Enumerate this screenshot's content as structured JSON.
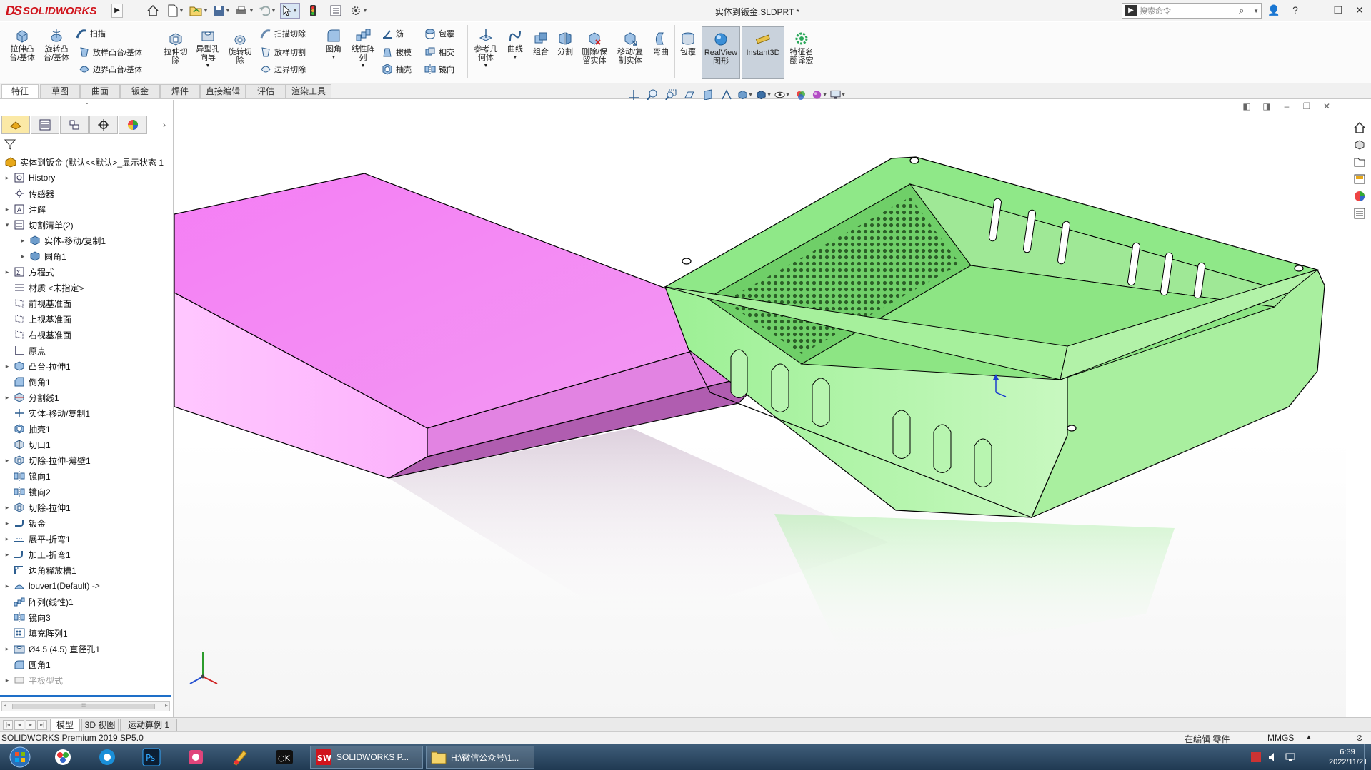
{
  "app": {
    "brand_prefix": "DS",
    "brand_name": "SOLIDWORKS",
    "document_title": "实体到钣金.SLDPRT *"
  },
  "search": {
    "placeholder": "搜索命令"
  },
  "command_manager": {
    "tools_large": [
      {
        "label": "拉伸凸\n台/基体"
      },
      {
        "label": "旋转凸\n台/基体"
      },
      {
        "label": "拉伸切\n除"
      },
      {
        "label": "异型孔\n向导"
      },
      {
        "label": "旋转切\n除"
      },
      {
        "label": "圆角"
      },
      {
        "label": "线性阵\n列"
      },
      {
        "label": "参考几\n何体"
      },
      {
        "label": "曲线"
      },
      {
        "label": "组合"
      },
      {
        "label": "分割"
      },
      {
        "label": "删除/保\n留实体"
      },
      {
        "label": "移动/复\n制实体"
      },
      {
        "label": "弯曲"
      },
      {
        "label": "包覆"
      },
      {
        "label": "RealView\n图形"
      },
      {
        "label": "Instant3D"
      },
      {
        "label": "特征名\n翻译宏"
      }
    ],
    "tools_small": [
      {
        "label": "扫描"
      },
      {
        "label": "放样凸台/基体"
      },
      {
        "label": "边界凸台/基体"
      },
      {
        "label": "扫描切除"
      },
      {
        "label": "放样切割"
      },
      {
        "label": "边界切除"
      },
      {
        "label": "筋"
      },
      {
        "label": "拔模"
      },
      {
        "label": "抽壳"
      },
      {
        "label": "包覆"
      },
      {
        "label": "相交"
      },
      {
        "label": "镜向"
      }
    ]
  },
  "tabs": [
    {
      "label": "特征",
      "active": true
    },
    {
      "label": "草图"
    },
    {
      "label": "曲面"
    },
    {
      "label": "钣金"
    },
    {
      "label": "焊件"
    },
    {
      "label": "直接编辑"
    },
    {
      "label": "评估"
    },
    {
      "label": "渲染工具"
    }
  ],
  "feature_tree": {
    "root": "实体到钣金 (默认<<默认>_显示状态 1",
    "nodes": [
      {
        "label": "History",
        "icon": "history-icon",
        "expand": true,
        "indent": 0
      },
      {
        "label": "传感器",
        "icon": "sensor-icon",
        "expand": false,
        "indent": 0
      },
      {
        "label": "注解",
        "icon": "annotation-icon",
        "expand": true,
        "indent": 0
      },
      {
        "label": "切割清单(2)",
        "icon": "cut-list-icon",
        "expand": "open",
        "indent": 0
      },
      {
        "label": "实体-移动/复制1",
        "icon": "solid-body-icon",
        "expand": true,
        "indent": 1
      },
      {
        "label": "圆角1",
        "icon": "solid-body-icon",
        "expand": true,
        "indent": 1
      },
      {
        "label": "方程式",
        "icon": "equation-icon",
        "expand": true,
        "indent": 0
      },
      {
        "label": "材质 <未指定>",
        "icon": "material-icon",
        "expand": false,
        "indent": 0
      },
      {
        "label": "前视基准面",
        "icon": "plane-icon",
        "expand": false,
        "indent": 0
      },
      {
        "label": "上视基准面",
        "icon": "plane-icon",
        "expand": false,
        "indent": 0
      },
      {
        "label": "右视基准面",
        "icon": "plane-icon",
        "expand": false,
        "indent": 0
      },
      {
        "label": "原点",
        "icon": "origin-icon",
        "expand": false,
        "indent": 0
      },
      {
        "label": "凸台-拉伸1",
        "icon": "extrude-icon",
        "expand": true,
        "indent": 0
      },
      {
        "label": "倒角1",
        "icon": "chamfer-icon",
        "expand": false,
        "indent": 0
      },
      {
        "label": "分割线1",
        "icon": "split-line-icon",
        "expand": true,
        "indent": 0
      },
      {
        "label": "实体-移动/复制1",
        "icon": "move-copy-icon",
        "expand": false,
        "indent": 0
      },
      {
        "label": "抽壳1",
        "icon": "shell-icon",
        "expand": false,
        "indent": 0
      },
      {
        "label": "切口1",
        "icon": "rip-icon",
        "expand": false,
        "indent": 0
      },
      {
        "label": "切除-拉伸-薄壁1",
        "icon": "cut-extrude-icon",
        "expand": true,
        "indent": 0
      },
      {
        "label": "镜向1",
        "icon": "mirror-icon",
        "expand": false,
        "indent": 0
      },
      {
        "label": "镜向2",
        "icon": "mirror-icon",
        "expand": false,
        "indent": 0
      },
      {
        "label": "切除-拉伸1",
        "icon": "cut-extrude-icon",
        "expand": true,
        "indent": 0
      },
      {
        "label": "钣金",
        "icon": "sheet-metal-icon",
        "expand": true,
        "indent": 0
      },
      {
        "label": "展平-折弯1",
        "icon": "flatten-bends-icon",
        "expand": true,
        "indent": 0
      },
      {
        "label": "加工-折弯1",
        "icon": "process-bends-icon",
        "expand": true,
        "indent": 0
      },
      {
        "label": "边角释放槽1",
        "icon": "corner-relief-icon",
        "expand": false,
        "indent": 0
      },
      {
        "label": "louver1(Default) ->",
        "icon": "forming-tool-icon",
        "expand": true,
        "indent": 0
      },
      {
        "label": "阵列(线性)1",
        "icon": "linear-pattern-icon",
        "expand": false,
        "indent": 0
      },
      {
        "label": "镜向3",
        "icon": "mirror-icon",
        "expand": false,
        "indent": 0
      },
      {
        "label": "填充阵列1",
        "icon": "fill-pattern-icon",
        "expand": false,
        "indent": 0
      },
      {
        "label": "Ø4.5 (4.5) 直径孔1",
        "icon": "hole-icon",
        "expand": true,
        "indent": 0
      },
      {
        "label": "圆角1",
        "icon": "fillet-icon",
        "expand": false,
        "indent": 0
      },
      {
        "label": "平板型式",
        "icon": "flat-pattern-icon",
        "expand": true,
        "indent": 0,
        "grey": true
      }
    ]
  },
  "model_tabs": [
    {
      "label": "模型",
      "active": true
    },
    {
      "label": "3D 视图"
    },
    {
      "label": "运动算例 1"
    }
  ],
  "status": {
    "product": "SOLIDWORKS Premium 2019 SP5.0",
    "mode": "在编辑 零件",
    "units": "MMGS"
  },
  "taskbar": {
    "windows": [
      {
        "label": "SOLIDWORKS P..."
      },
      {
        "label": "H:\\微信公众号\\1..."
      }
    ],
    "time": "6:39",
    "date": "2022/11/21"
  },
  "colors": {
    "part_pink": "#f58af5",
    "part_green": "#86ec7e",
    "brand_red": "#d0141c",
    "tree_selection_blue": "#1e6fc8"
  }
}
